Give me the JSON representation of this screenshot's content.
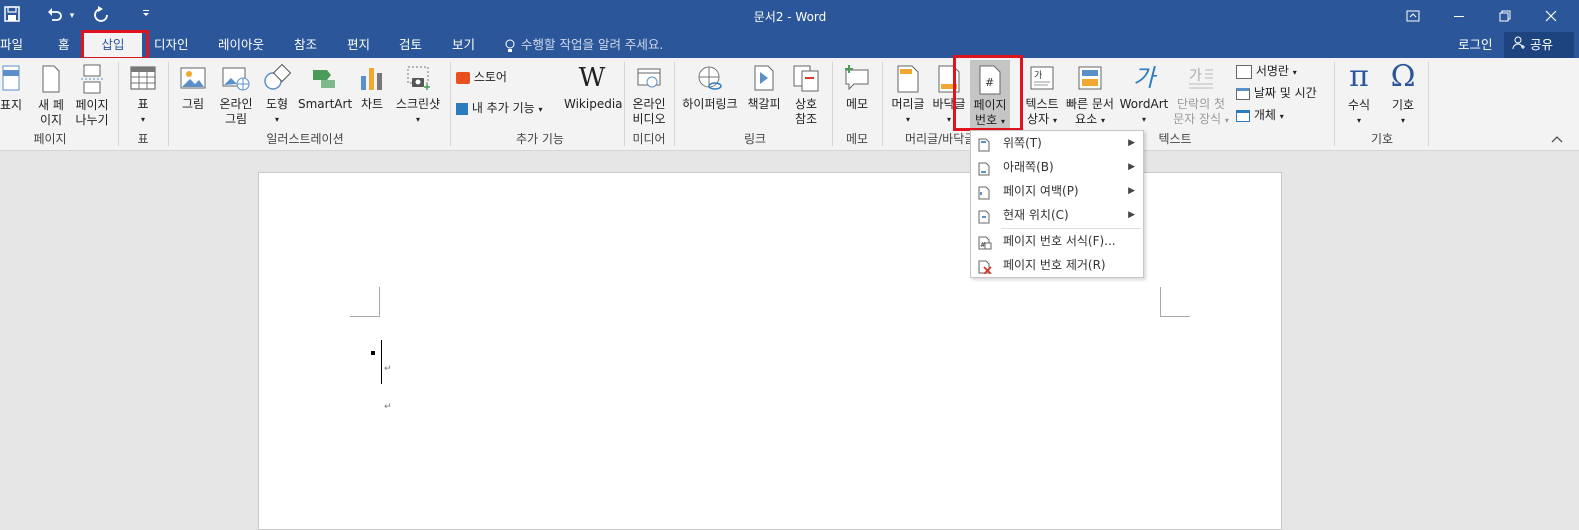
{
  "window": {
    "title": "문서2 - Word",
    "qa_chevron": "▾"
  },
  "tabs": [
    {
      "label": "파일"
    },
    {
      "label": "홈"
    },
    {
      "label": "삽입"
    },
    {
      "label": "디자인"
    },
    {
      "label": "레이아웃"
    },
    {
      "label": "참조"
    },
    {
      "label": "편지"
    },
    {
      "label": "검토"
    },
    {
      "label": "보기"
    }
  ],
  "tellme": "수행할 작업을 알려 주세요.",
  "signin": "로그인",
  "share": "공유",
  "ribbon": {
    "page": {
      "cover": "표지",
      "new1": "새 페",
      "new2": "이지",
      "brk1": "페이지",
      "brk2": "나누기",
      "group": "페이지"
    },
    "table": {
      "label": "표",
      "group": "표"
    },
    "illus": {
      "picture": "그림",
      "online1": "온라인",
      "online2": "그림",
      "shapes": "도형",
      "smartart": "SmartArt",
      "chart": "차트",
      "screenshot": "스크린샷",
      "group": "일러스트레이션"
    },
    "addins": {
      "store": "스토어",
      "myaddins": "내 추가 기능",
      "wiki": "Wikipedia",
      "group": "추가 기능"
    },
    "media": {
      "video1": "온라인",
      "video2": "비디오",
      "group": "미디어"
    },
    "links": {
      "hyperlink": "하이퍼링크",
      "bookmark": "책갈피",
      "xref1": "상호",
      "xref2": "참조",
      "group": "링크"
    },
    "comments": {
      "memo": "메모",
      "group": "메모"
    },
    "hf": {
      "header": "머리글",
      "footer": "바닥글",
      "pn1": "페이지",
      "pn2": "번호",
      "group": "머리글/바닥글"
    },
    "text": {
      "tb1": "텍스트",
      "tb2": "상자",
      "qp1": "빠른 문서",
      "qp2": "요소",
      "wordart": "WordArt",
      "dc1": "단락의 첫",
      "dc2": "문자 장식",
      "sig": "서명란",
      "date": "날짜 및 시간",
      "obj": "개체",
      "group": "텍스트"
    },
    "symbols": {
      "eq": "수식",
      "sym": "기호",
      "group": "기호"
    }
  },
  "pagenum_menu": [
    {
      "label": "위쪽(T)",
      "submenu": true
    },
    {
      "label": "아래쪽(B)",
      "submenu": true
    },
    {
      "label": "페이지 여백(P)",
      "submenu": true
    },
    {
      "label": "현재 위치(C)",
      "submenu": true
    },
    {
      "label": "페이지 번호 서식(F)...",
      "submenu": false
    },
    {
      "label": "페이지 번호 제거(R)",
      "submenu": false
    }
  ],
  "icons": [
    "save-icon",
    "undo-icon",
    "redo-icon",
    "lightbulb-icon",
    "person-icon",
    "ribbon-display-icon",
    "restore-icon",
    "close-icon"
  ]
}
